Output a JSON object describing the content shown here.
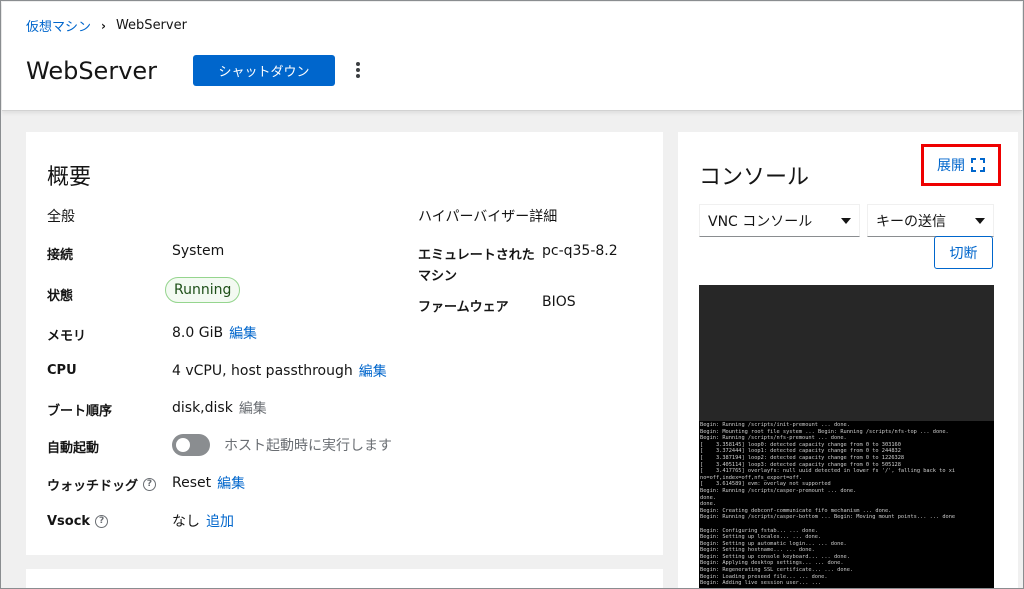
{
  "breadcrumb": {
    "parent": "仮想マシン",
    "separator": "›",
    "current": "WebServer"
  },
  "header": {
    "title": "WebServer",
    "primary_action": "シャットダウン",
    "kebab_icon": "kebab-menu-icon"
  },
  "overview": {
    "title": "概要",
    "general": {
      "section_title": "全般",
      "connection": {
        "label": "接続",
        "value": "System"
      },
      "state": {
        "label": "状態",
        "value": "Running"
      },
      "memory": {
        "label": "メモリ",
        "value": "8.0 GiB",
        "action": "編集"
      },
      "cpu": {
        "label": "CPU",
        "value": "4 vCPU, host passthrough",
        "action": "編集"
      },
      "boot_order": {
        "label": "ブート順序",
        "value": "disk,disk",
        "action": "編集"
      },
      "autostart": {
        "label": "自動起動",
        "toggle_label": "ホスト起動時に実行します",
        "enabled": false
      },
      "watchdog": {
        "label": "ウォッチドッグ",
        "value": "Reset",
        "action": "編集"
      },
      "vsock": {
        "label": "Vsock",
        "value": "なし",
        "action": "追加"
      }
    },
    "hypervisor": {
      "section_title": "ハイパーバイザー詳細",
      "emulated_machine": {
        "label_line1": "エミュレートされた",
        "label_line2": "マシン",
        "value": "pc-q35-8.2"
      },
      "firmware": {
        "label": "ファームウェア",
        "value": "BIOS"
      }
    }
  },
  "console": {
    "title": "コンソール",
    "expand_label": "展開",
    "expand_icon": "expand-icon",
    "console_type": "VNC コンソール",
    "send_key": "キーの送信",
    "disconnect": "切断",
    "log": "Begin: Running /scripts/init-premount ... done.\nBegin: Mounting root file system ... Begin: Running /scripts/nfs-top ... done.\nBegin: Running /scripts/nfs-premount ... done.\n[    3.358145] loop0: detected capacity change from 0 to 303160\n[    3.372444] loop1: detected capacity change from 0 to 244832\n[    3.387194] loop2: detected capacity change from 0 to 1226328\n[    3.405114] loop3: detected capacity change from 0 to 505128\n[    3.417765] overlayfs: null uuid detected in lower fs '/', falling back to xi\nno=off,index=off,nfs_export=off.\n[    3.614589] evm: overlay not supported\nBegin: Running /scripts/casper-premount ... done.\ndone.\ndone.\nBegin: Creating debconf-communicate fifo mechanism ... done.\nBegin: Running /scripts/casper-bottom ... Begin: Moving mount points... ... done\n\nBegin: Configuring fstab... ... done.\nBegin: Setting up locales... ... done.\nBegin: Setting up automatic login... ... done.\nBegin: Setting hostname... ... done.\nBegin: Setting up console keyboard... ... done.\nBegin: Applying desktop settings... ... done.\nBegin: Regenerating SSL certificate... ... done.\nBegin: Loading preseed file... ... done.\nBegin: Adding live session user... ..."
  },
  "colors": {
    "primary": "#0066cc",
    "highlight": "#ee0000",
    "running_bg": "#f3faf2",
    "running_border": "#95d58e"
  }
}
